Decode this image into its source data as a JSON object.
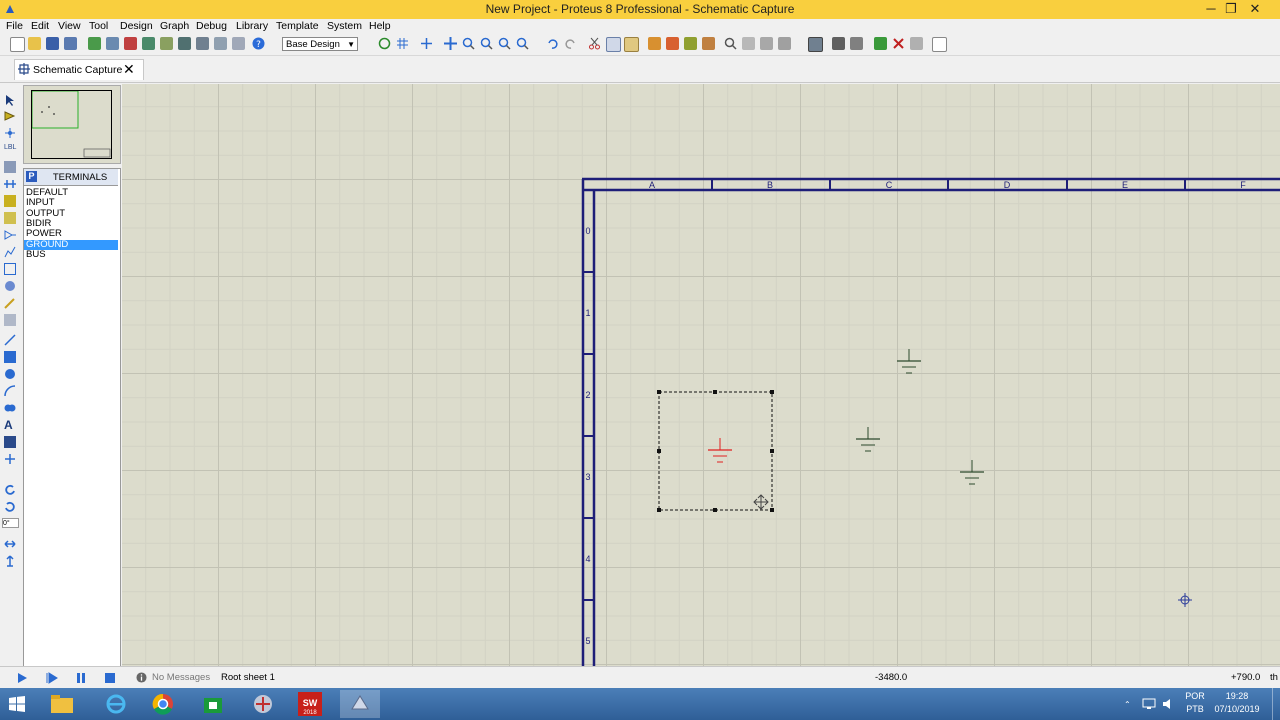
{
  "window": {
    "title": "New Project - Proteus 8 Professional - Schematic Capture",
    "minimize": "─",
    "maximize": "❐",
    "close": "✕"
  },
  "menu": [
    "File",
    "Edit",
    "View",
    "Tool",
    "Design",
    "Graph",
    "Debug",
    "Library",
    "Template",
    "System",
    "Help"
  ],
  "toolbar": {
    "design_select": "Base Design"
  },
  "tab": {
    "label": "Schematic Capture",
    "close": "✕"
  },
  "left_tools": {
    "rotation_value": "0°"
  },
  "terminals": {
    "mode_button": "P",
    "header": "TERMINALS",
    "items": [
      "DEFAULT",
      "INPUT",
      "OUTPUT",
      "BIDIR",
      "POWER",
      "GROUND",
      "BUS"
    ],
    "selected": "GROUND"
  },
  "sheet": {
    "columns": [
      "A",
      "B",
      "C",
      "D",
      "E",
      "F"
    ],
    "rows": [
      "0",
      "1",
      "2",
      "3",
      "4",
      "5"
    ]
  },
  "status": {
    "messages": "No Messages",
    "sheet": "Root sheet 1",
    "coord_x": "-3480.0",
    "coord_y": "+790.0",
    "unit": "th"
  },
  "tray": {
    "language_top": "POR",
    "language_bottom": "PTB",
    "time": "19:28",
    "date": "07/10/2019"
  },
  "colors": {
    "titlebar": "#f9cf3e",
    "sheet_border": "#1e1e78",
    "ground_symbol": "#2c4a2c",
    "selected_symbol": "#e02020",
    "selection_highlight": "#3399ff",
    "canvas_bg": "#dcdccc"
  }
}
